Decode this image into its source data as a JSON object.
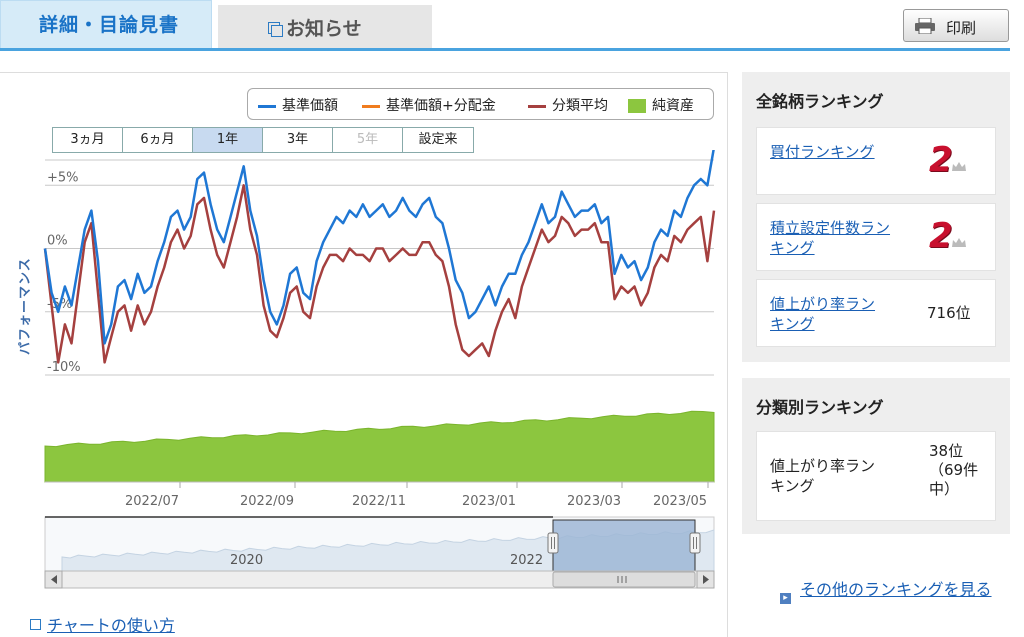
{
  "tabs": {
    "active": "詳細・目論見書",
    "inactive": "お知らせ",
    "print": "印刷"
  },
  "legend": {
    "items": [
      {
        "label": "基準価額",
        "color": "#1f77d4"
      },
      {
        "label": "基準価額+分配金",
        "color": "#f07c1e"
      },
      {
        "label": "分類平均",
        "color": "#a5403f"
      },
      {
        "label": "純資産",
        "color": "#8cc63f"
      }
    ]
  },
  "range_buttons": {
    "items": [
      "3ヵ月",
      "6ヵ月",
      "1年",
      "3年",
      "5年",
      "設定来"
    ],
    "active": "1年",
    "disabled": "5年"
  },
  "chart_data": {
    "type": "line",
    "ylabel": "パフォーマンス",
    "y_ticks": [
      "+5%",
      "0%",
      "-5%",
      "-10%"
    ],
    "ylim": [
      -10,
      7
    ],
    "x_ticks": [
      "2022/07",
      "2022/09",
      "2022/11",
      "2023/01",
      "2023/03",
      "2023/05"
    ],
    "series": [
      {
        "name": "基準価額",
        "color": "#1f77d4",
        "values": [
          0.0,
          -3.5,
          -5.0,
          -3.0,
          -4.5,
          -1.5,
          1.5,
          3.0,
          -1.0,
          -7.5,
          -6.0,
          -3.0,
          -2.5,
          -4.0,
          -2.0,
          -3.5,
          -3.0,
          -1.0,
          0.5,
          2.5,
          3.0,
          1.5,
          2.5,
          5.5,
          6.0,
          3.5,
          1.5,
          0.5,
          2.5,
          4.5,
          6.5,
          3.0,
          1.0,
          -2.5,
          -5.0,
          -6.0,
          -4.5,
          -2.0,
          -1.5,
          -3.5,
          -4.0,
          -1.0,
          0.5,
          1.5,
          2.5,
          2.0,
          3.0,
          2.5,
          3.5,
          2.5,
          3.0,
          3.5,
          2.5,
          3.0,
          4.0,
          3.0,
          2.5,
          3.5,
          4.0,
          2.5,
          2.0,
          0.0,
          -2.5,
          -3.5,
          -5.5,
          -5.0,
          -4.0,
          -3.0,
          -4.5,
          -3.0,
          -2.0,
          -2.0,
          -0.5,
          0.5,
          2.0,
          3.5,
          2.0,
          2.5,
          4.5,
          3.5,
          2.5,
          3.0,
          3.0,
          3.5,
          2.0,
          2.5,
          -2.0,
          -0.5,
          -1.5,
          -1.0,
          -2.5,
          -1.5,
          0.5,
          1.5,
          1.0,
          3.0,
          2.5,
          4.0,
          5.0,
          5.5,
          5.0,
          8.0
        ]
      },
      {
        "name": "分類平均",
        "color": "#a5403f",
        "values": [
          0.0,
          -4.5,
          -9.0,
          -6.0,
          -7.5,
          -3.5,
          0.5,
          2.0,
          -3.5,
          -9.0,
          -7.0,
          -5.0,
          -4.5,
          -6.5,
          -4.5,
          -6.0,
          -5.0,
          -3.0,
          -1.5,
          0.5,
          1.5,
          0.0,
          1.0,
          3.5,
          4.0,
          1.5,
          -0.5,
          -1.5,
          0.5,
          2.5,
          5.0,
          1.5,
          -0.5,
          -4.5,
          -6.5,
          -7.0,
          -5.5,
          -3.5,
          -3.0,
          -5.0,
          -5.5,
          -3.0,
          -1.5,
          -0.5,
          -0.5,
          -1.0,
          0.0,
          -0.5,
          -0.5,
          -1.0,
          0.0,
          0.0,
          -1.0,
          -0.5,
          0.0,
          -0.5,
          -0.5,
          0.5,
          0.5,
          -0.5,
          -1.0,
          -3.0,
          -6.0,
          -8.0,
          -8.5,
          -8.0,
          -7.5,
          -8.5,
          -6.5,
          -5.0,
          -4.0,
          -5.5,
          -3.0,
          -1.5,
          0.0,
          1.5,
          0.5,
          1.0,
          2.5,
          2.0,
          1.0,
          1.5,
          1.5,
          2.0,
          0.5,
          0.5,
          -4.0,
          -3.0,
          -3.5,
          -3.0,
          -4.5,
          -3.5,
          -1.5,
          -0.5,
          -1.0,
          1.0,
          0.5,
          1.5,
          2.0,
          2.5,
          -1.0,
          3.0
        ]
      }
    ],
    "net_assets": {
      "name": "純資産",
      "color": "#8cc63f"
    },
    "navigator": {
      "labels": [
        "2020",
        "2022"
      ]
    }
  },
  "sidebar": {
    "all_ranking": {
      "title": "全銘柄ランキング",
      "items": [
        {
          "label": "買付ランキング",
          "value": "2",
          "style": "big"
        },
        {
          "label": "積立設定件数ランキング",
          "value": "2",
          "style": "big"
        },
        {
          "label": "値上がり率ランキング",
          "value": "716位",
          "style": "plain"
        }
      ]
    },
    "category_ranking": {
      "title": "分類別ランキング",
      "items": [
        {
          "label": "値上がり率ランキング",
          "value": "38位（69件中）"
        }
      ]
    },
    "more_link": "その他のランキングを見る"
  },
  "help_link": "チャートの使い方"
}
